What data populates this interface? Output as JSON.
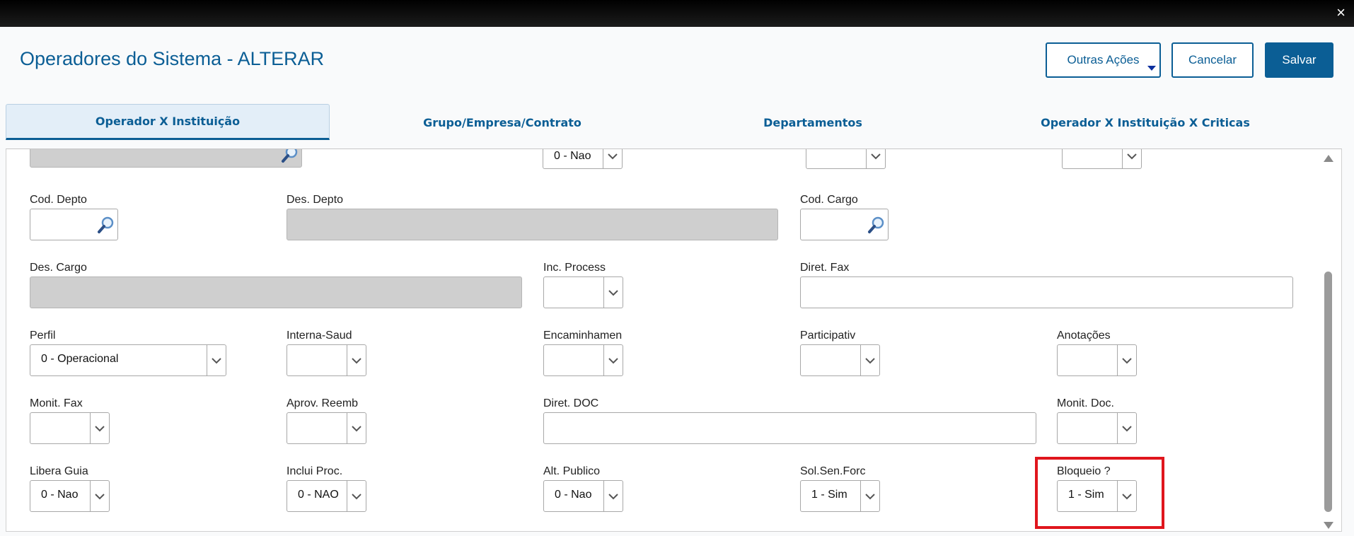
{
  "window": {
    "close_glyph": "×"
  },
  "header": {
    "title": "Operadores do Sistema - ALTERAR",
    "buttons": {
      "outras": "Outras Ações",
      "cancelar": "Cancelar",
      "salvar": "Salvar"
    }
  },
  "tabs": [
    {
      "label": "Operador X Instituição",
      "active": true
    },
    {
      "label": "Grupo/Empresa/Contrato",
      "active": false
    },
    {
      "label": "Departamentos",
      "active": false
    },
    {
      "label": "Operador X Instituição X Criticas",
      "active": false
    }
  ],
  "form": {
    "row0": {
      "select_value": "0 - Nao"
    },
    "cod_depto": {
      "label": "Cod. Depto"
    },
    "des_depto": {
      "label": "Des. Depto"
    },
    "cod_cargo": {
      "label": "Cod. Cargo"
    },
    "des_cargo": {
      "label": "Des. Cargo"
    },
    "inc_process": {
      "label": "Inc. Process",
      "value": ""
    },
    "diret_fax": {
      "label": "Diret. Fax",
      "value": ""
    },
    "perfil": {
      "label": "Perfil",
      "value": "0 - Operacional"
    },
    "interna_saud": {
      "label": "Interna-Saud",
      "value": ""
    },
    "encaminhamen": {
      "label": "Encaminhamen",
      "value": ""
    },
    "participativ": {
      "label": "Participativ",
      "value": ""
    },
    "anotacoes": {
      "label": "Anotações",
      "value": ""
    },
    "monit_fax": {
      "label": "Monit. Fax",
      "value": ""
    },
    "aprov_reemb": {
      "label": "Aprov. Reemb",
      "value": ""
    },
    "diret_doc": {
      "label": "Diret. DOC",
      "value": ""
    },
    "monit_doc": {
      "label": "Monit. Doc.",
      "value": ""
    },
    "libera_guia": {
      "label": "Libera Guia",
      "value": "0 - Nao"
    },
    "inclui_proc": {
      "label": "Inclui Proc.",
      "value": "0 - NAO"
    },
    "alt_publico": {
      "label": "Alt. Publico",
      "value": "0 - Nao"
    },
    "sol_sen_forc": {
      "label": "Sol.Sen.Forc",
      "value": "1 - Sim"
    },
    "bloqueio": {
      "label": "Bloqueio ?",
      "value": "1 - Sim"
    }
  },
  "colors": {
    "accent": "#0b5e95",
    "highlight": "#e0161d",
    "disabled": "#cfcfcf"
  },
  "icons": [
    "close-icon",
    "caret-down-icon",
    "search-icon",
    "chevron-down-icon",
    "scroll-up-icon",
    "scroll-down-icon"
  ]
}
